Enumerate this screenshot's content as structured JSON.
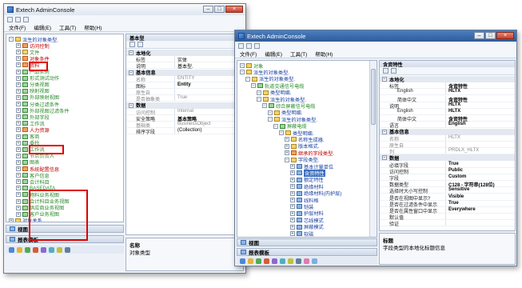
{
  "w1": {
    "title": "Extech AdminConsole",
    "menu": [
      "文件(F)",
      "编辑(E)",
      "工具(T)",
      "帮助(H)"
    ],
    "tree": [
      {
        "label": "派生的对象类型.",
        "color": "blu",
        "indent": 0,
        "toggle": "-",
        "icon": "y"
      },
      {
        "label": "访问控制",
        "color": "red",
        "indent": 1,
        "toggle": "+",
        "icon": "o"
      },
      {
        "label": "文件",
        "color": "grn",
        "indent": 1,
        "toggle": "+",
        "icon": "y"
      },
      {
        "label": "对象条件",
        "color": "red",
        "indent": 1,
        "toggle": "+",
        "icon": "o"
      },
      {
        "label": "资料",
        "color": "red",
        "indent": 1,
        "toggle": "+",
        "icon": "o"
      },
      {
        "label": "产品实例",
        "color": "grn",
        "indent": 1,
        "toggle": "+",
        "icon": "g"
      },
      {
        "label": "形式测试动作",
        "color": "grn",
        "indent": 1,
        "toggle": "+",
        "icon": "g"
      },
      {
        "label": "分类视图",
        "color": "grn",
        "indent": 1,
        "toggle": "+",
        "icon": "g"
      },
      {
        "label": "映射视图",
        "color": "grn",
        "indent": 1,
        "toggle": "+",
        "icon": "g"
      },
      {
        "label": "外部映射视图",
        "color": "grn",
        "indent": 1,
        "toggle": "+",
        "icon": "g"
      },
      {
        "label": "分类过滤条件",
        "color": "grn",
        "indent": 1,
        "toggle": "+",
        "icon": "g"
      },
      {
        "label": "外部视图过滤条件",
        "color": "grn",
        "indent": 1,
        "toggle": "+",
        "icon": "g"
      },
      {
        "label": "外部字段",
        "color": "grn",
        "indent": 1,
        "toggle": "+",
        "icon": "g"
      },
      {
        "label": "工作流",
        "color": "grn",
        "indent": 1,
        "toggle": "+",
        "icon": "g"
      },
      {
        "label": "人力资源",
        "color": "red",
        "indent": 1,
        "toggle": "+",
        "icon": "o"
      },
      {
        "label": "客商",
        "color": "grn",
        "indent": 1,
        "toggle": "+",
        "icon": "g"
      },
      {
        "label": "委托",
        "color": "grn",
        "indent": 1,
        "toggle": "+",
        "icon": "g"
      },
      {
        "label": "工作流",
        "color": "grn",
        "indent": 1,
        "toggle": "+",
        "icon": "g"
      },
      {
        "label": "节点负责人",
        "color": "grn",
        "indent": 1,
        "toggle": "+",
        "icon": "g"
      },
      {
        "label": "图表",
        "color": "grn",
        "indent": 1,
        "toggle": "+",
        "icon": "g"
      },
      {
        "label": "系统配置信息",
        "color": "red",
        "indent": 1,
        "toggle": "+",
        "icon": "o"
      },
      {
        "label": "客户信息",
        "color": "grn",
        "indent": 1,
        "toggle": "+",
        "icon": "g"
      },
      {
        "label": "会计科目",
        "color": "grn",
        "indent": 1,
        "toggle": "+",
        "icon": "g"
      },
      {
        "label": "BASEDATA",
        "color": "grn",
        "indent": 1,
        "toggle": "+",
        "icon": "g"
      },
      {
        "label": "物料业务视图",
        "color": "grn",
        "indent": 1,
        "toggle": "+",
        "icon": "g"
      },
      {
        "label": "会计科目业务视图",
        "color": "grn",
        "indent": 1,
        "toggle": "+",
        "icon": "g"
      },
      {
        "label": "供应商业务视图",
        "color": "grn",
        "indent": 1,
        "toggle": "+",
        "icon": "g"
      },
      {
        "label": "客户业务视图",
        "color": "grn",
        "indent": 1,
        "toggle": "+",
        "icon": "g"
      },
      {
        "label": "对象关系.",
        "color": "blu",
        "indent": 0,
        "toggle": "+",
        "icon": "y"
      }
    ],
    "props_title": "基本型",
    "props": [
      {
        "cat": "本地化"
      },
      {
        "k": "标签",
        "v": "实体"
      },
      {
        "k": "说明",
        "v": "基本型."
      },
      {
        "cat": "基本信息"
      },
      {
        "k": "名称",
        "v": "ENTITY",
        "dim": true
      },
      {
        "k": "图标",
        "v": "Entity",
        "bold": true
      },
      {
        "k": "原生自",
        "v": "",
        "dim": true
      },
      {
        "k": "是否抽象类",
        "v": "True",
        "dim": true
      },
      {
        "cat": "数据"
      },
      {
        "k": "访问控制",
        "v": "Internal",
        "dim": true
      },
      {
        "k": "安全策略",
        "v": "基本策略",
        "bold": true
      },
      {
        "k": "基础类",
        "v": "BusinessObject",
        "dim": true
      },
      {
        "k": "排序字段",
        "v": "(Collection)"
      }
    ],
    "view_label": "视图",
    "report_label": "报表模板",
    "desc_title": "名称",
    "desc_text": "对象类型"
  },
  "w2": {
    "title": "Extech AdminConsole",
    "menu": [
      "文件(F)",
      "编辑(E)",
      "工具(T)",
      "帮助(H)"
    ],
    "tree": [
      {
        "label": "对象",
        "color": "grn",
        "indent": 0,
        "toggle": "-",
        "icon": "y"
      },
      {
        "label": "派生的对象类型.",
        "color": "blu",
        "indent": 0,
        "toggle": "-",
        "icon": "y"
      },
      {
        "label": "派生的对象类型.",
        "color": "blu",
        "indent": 1,
        "toggle": "-",
        "icon": "y"
      },
      {
        "label": "轨道交通信号电缆",
        "color": "grn",
        "indent": 2,
        "toggle": "-",
        "icon": "g"
      },
      {
        "label": "类型明细.",
        "color": "blu",
        "indent": 3,
        "toggle": "-",
        "icon": "y"
      },
      {
        "label": "派生的对象类型.",
        "color": "blu",
        "indent": 3,
        "toggle": "-",
        "icon": "y"
      },
      {
        "label": "综合屏蔽信号电缆",
        "color": "grn",
        "indent": 4,
        "toggle": "-",
        "icon": "g"
      },
      {
        "label": "类型明细.",
        "color": "blu",
        "indent": 5,
        "toggle": "-",
        "icon": "y"
      },
      {
        "label": "派生的对象类型.",
        "color": "blu",
        "indent": 5,
        "toggle": "-",
        "icon": "y"
      },
      {
        "label": "屏蔽电缆",
        "color": "grn",
        "indent": 6,
        "toggle": "-",
        "icon": "g"
      },
      {
        "label": "类型明细.",
        "color": "blu",
        "indent": 7,
        "toggle": "-",
        "icon": "y"
      },
      {
        "label": "名称生成器.",
        "color": "blu",
        "indent": 8,
        "toggle": "+",
        "icon": "y"
      },
      {
        "label": "版本格式.",
        "color": "blu",
        "indent": 8,
        "toggle": "+",
        "icon": "y"
      },
      {
        "label": "继承的字段类型.",
        "color": "red",
        "indent": 8,
        "toggle": "+",
        "icon": "o"
      },
      {
        "label": "字段类型.",
        "color": "blu",
        "indent": 8,
        "toggle": "-",
        "icon": "y"
      },
      {
        "label": "基本计量单位",
        "color": "blu",
        "indent": 9,
        "toggle": "+",
        "icon": "b"
      },
      {
        "label": "含资特性",
        "color": "blu",
        "indent": 9,
        "toggle": "+",
        "icon": "b",
        "selected": true
      },
      {
        "label": "额定特性",
        "color": "blu",
        "indent": 9,
        "toggle": "+",
        "icon": "b"
      },
      {
        "label": "绝缘材料",
        "color": "blu",
        "indent": 9,
        "toggle": "+",
        "icon": "b"
      },
      {
        "label": "绝缘材料(内护层)",
        "color": "blu",
        "indent": 9,
        "toggle": "+",
        "icon": "b"
      },
      {
        "label": "线料格",
        "color": "blu",
        "indent": 9,
        "toggle": "+",
        "icon": "b"
      },
      {
        "label": "铠装",
        "color": "blu",
        "indent": 9,
        "toggle": "+",
        "icon": "b"
      },
      {
        "label": "护层材料",
        "color": "blu",
        "indent": 9,
        "toggle": "+",
        "icon": "b"
      },
      {
        "label": "芯线模式",
        "color": "blu",
        "indent": 9,
        "toggle": "+",
        "icon": "b"
      },
      {
        "label": "屏蔽模式",
        "color": "blu",
        "indent": 9,
        "toggle": "+",
        "icon": "b"
      },
      {
        "label": "软磁",
        "color": "blu",
        "indent": 9,
        "toggle": "+",
        "icon": "b"
      }
    ],
    "props_title": "含资特性",
    "props": [
      {
        "cat": "本地化"
      },
      {
        "k": "标签",
        "v": "含资特性",
        "bold": true
      },
      {
        "k": "English",
        "v": "HLTX",
        "bold": true,
        "sub": true
      },
      {
        "k": "简体中文",
        "v": "含资特性",
        "bold": true,
        "sub": true
      },
      {
        "k": "说明",
        "v": "HLTX",
        "bold": true
      },
      {
        "k": "English",
        "v": "HLTX",
        "bold": true,
        "sub": true
      },
      {
        "k": "简体中文",
        "v": "含资特性",
        "bold": true,
        "sub": true
      },
      {
        "k": "语言",
        "v": "English",
        "bold": true
      },
      {
        "cat": "基本信息"
      },
      {
        "k": "名称",
        "v": "HLTX",
        "dim": true
      },
      {
        "k": "原生自",
        "v": "",
        "dim": true
      },
      {
        "k": "列",
        "v": "PRDLX_HLTX",
        "dim": true
      },
      {
        "cat": "数据"
      },
      {
        "k": "必填字段",
        "v": "True",
        "bold": true
      },
      {
        "k": "访问控制",
        "v": "Public",
        "bold": true
      },
      {
        "k": "字段",
        "v": "Custom",
        "bold": true
      },
      {
        "k": "数据类型",
        "v": "C128 - 字符串(128位)",
        "bold": true
      },
      {
        "k": "选择时大小写控制",
        "v": "Sensitive",
        "bold": true
      },
      {
        "k": "是否在视图中显示?",
        "v": "Visible",
        "bold": true
      },
      {
        "k": "是否在过滤条件中显示",
        "v": "True",
        "bold": true
      },
      {
        "k": "是否在属性窗口中显示",
        "v": "Everywhere",
        "bold": true
      },
      {
        "k": "默认值",
        "v": ""
      },
      {
        "k": "验证",
        "v": ""
      }
    ],
    "view_label": "视图",
    "report_label": "报表模板",
    "desc_title": "标题",
    "desc_text": "字段类型的本地化标题信息"
  }
}
